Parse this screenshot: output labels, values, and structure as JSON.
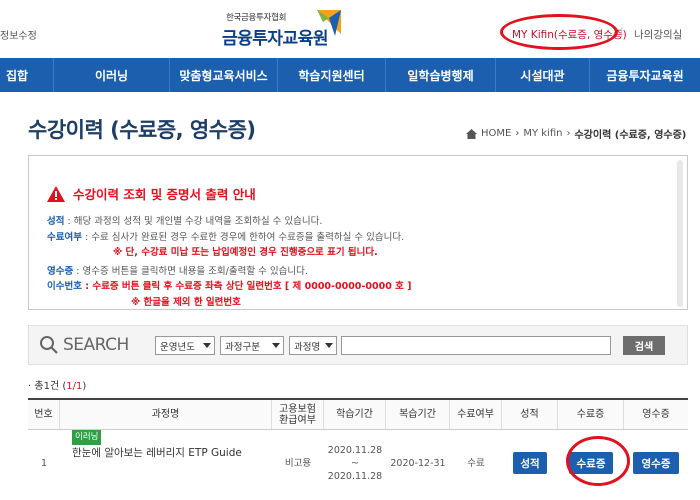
{
  "header": {
    "top_left_link": "정보수정",
    "logo_sub": "한국금융투자협회",
    "logo_main": "금융투자교육원",
    "mykifin_link": "MY Kifin(수료증, 영수증)",
    "separator": "|",
    "my_lecture_link": "나의강의실"
  },
  "nav": {
    "items": [
      {
        "label": "집합"
      },
      {
        "label": "이러닝"
      },
      {
        "label": "맞춤형교육서비스"
      },
      {
        "label": "학습지원센터"
      },
      {
        "label": "일학습병행제"
      },
      {
        "label": "시설대관"
      },
      {
        "label": "금융투자교육원"
      }
    ]
  },
  "page": {
    "title": "수강이력 (수료증, 영수증)",
    "breadcrumb": [
      "HOME",
      "MY kifin",
      "수강이력 (수료증, 영수증)"
    ],
    "breadcrumb_sep": "›"
  },
  "notice": {
    "title": "수강이력 조회 및 증명서 출력 안내",
    "grade_term": "성적",
    "grade_text": " : 해당 과정의 성적 및 개인별 수강 내역을 조회하실 수 있습니다.",
    "completion_term": "수료여부",
    "completion_text": " : 수료 심사가 완료된 경우 수료한 경우에 한하여 수료증을 출력하실 수 있습니다.",
    "completion_note": "※ 단, 수강료 미납 또는 납입예정인 경우 진행중으로 표기 됩니다.",
    "receipt_term": "영수증",
    "receipt_text": " : 영수증 버튼을 클릭하면 내용을 조회/출력할 수 있습니다.",
    "cert_no_term": "이수번호",
    "cert_no_text": " : 수료증 버튼 클릭 후 수료증 좌측 상단 일련번호 [ 제 0000-0000-0000 호 ]",
    "cert_no_note": "※ 한글을 제외 한 일련번호"
  },
  "search": {
    "label": "SEARCH",
    "select_year": "운영년도",
    "select_type": "과정구분",
    "select_name": "과정명",
    "input_value": "",
    "button_label": "검색"
  },
  "summary": {
    "prefix": "· 총",
    "count": "1",
    "suffix": "건 (",
    "page": "1/1",
    "close": ")"
  },
  "table": {
    "headers": [
      "번호",
      "과정명",
      "고용보험\n환급여부",
      "학습기간",
      "복습기간",
      "수료여부",
      "성적",
      "수료증",
      "영수증"
    ],
    "rows": [
      {
        "no": "1",
        "tag": "이러닝",
        "course": "한눈에 알아보는 레버리지 ETP Guide",
        "insurance": "비고용",
        "period_start": "2020.11.28",
        "period_tilde": "~",
        "period_end": "2020.11.28",
        "review": "2020-12-31",
        "status": "수료",
        "grade_btn": "성적",
        "cert_btn": "수료증",
        "receipt_btn": "영수증"
      }
    ]
  },
  "colors": {
    "nav_bg": "#1b5fae",
    "accent_red": "#e3101e",
    "title_navy": "#1f3e67"
  }
}
